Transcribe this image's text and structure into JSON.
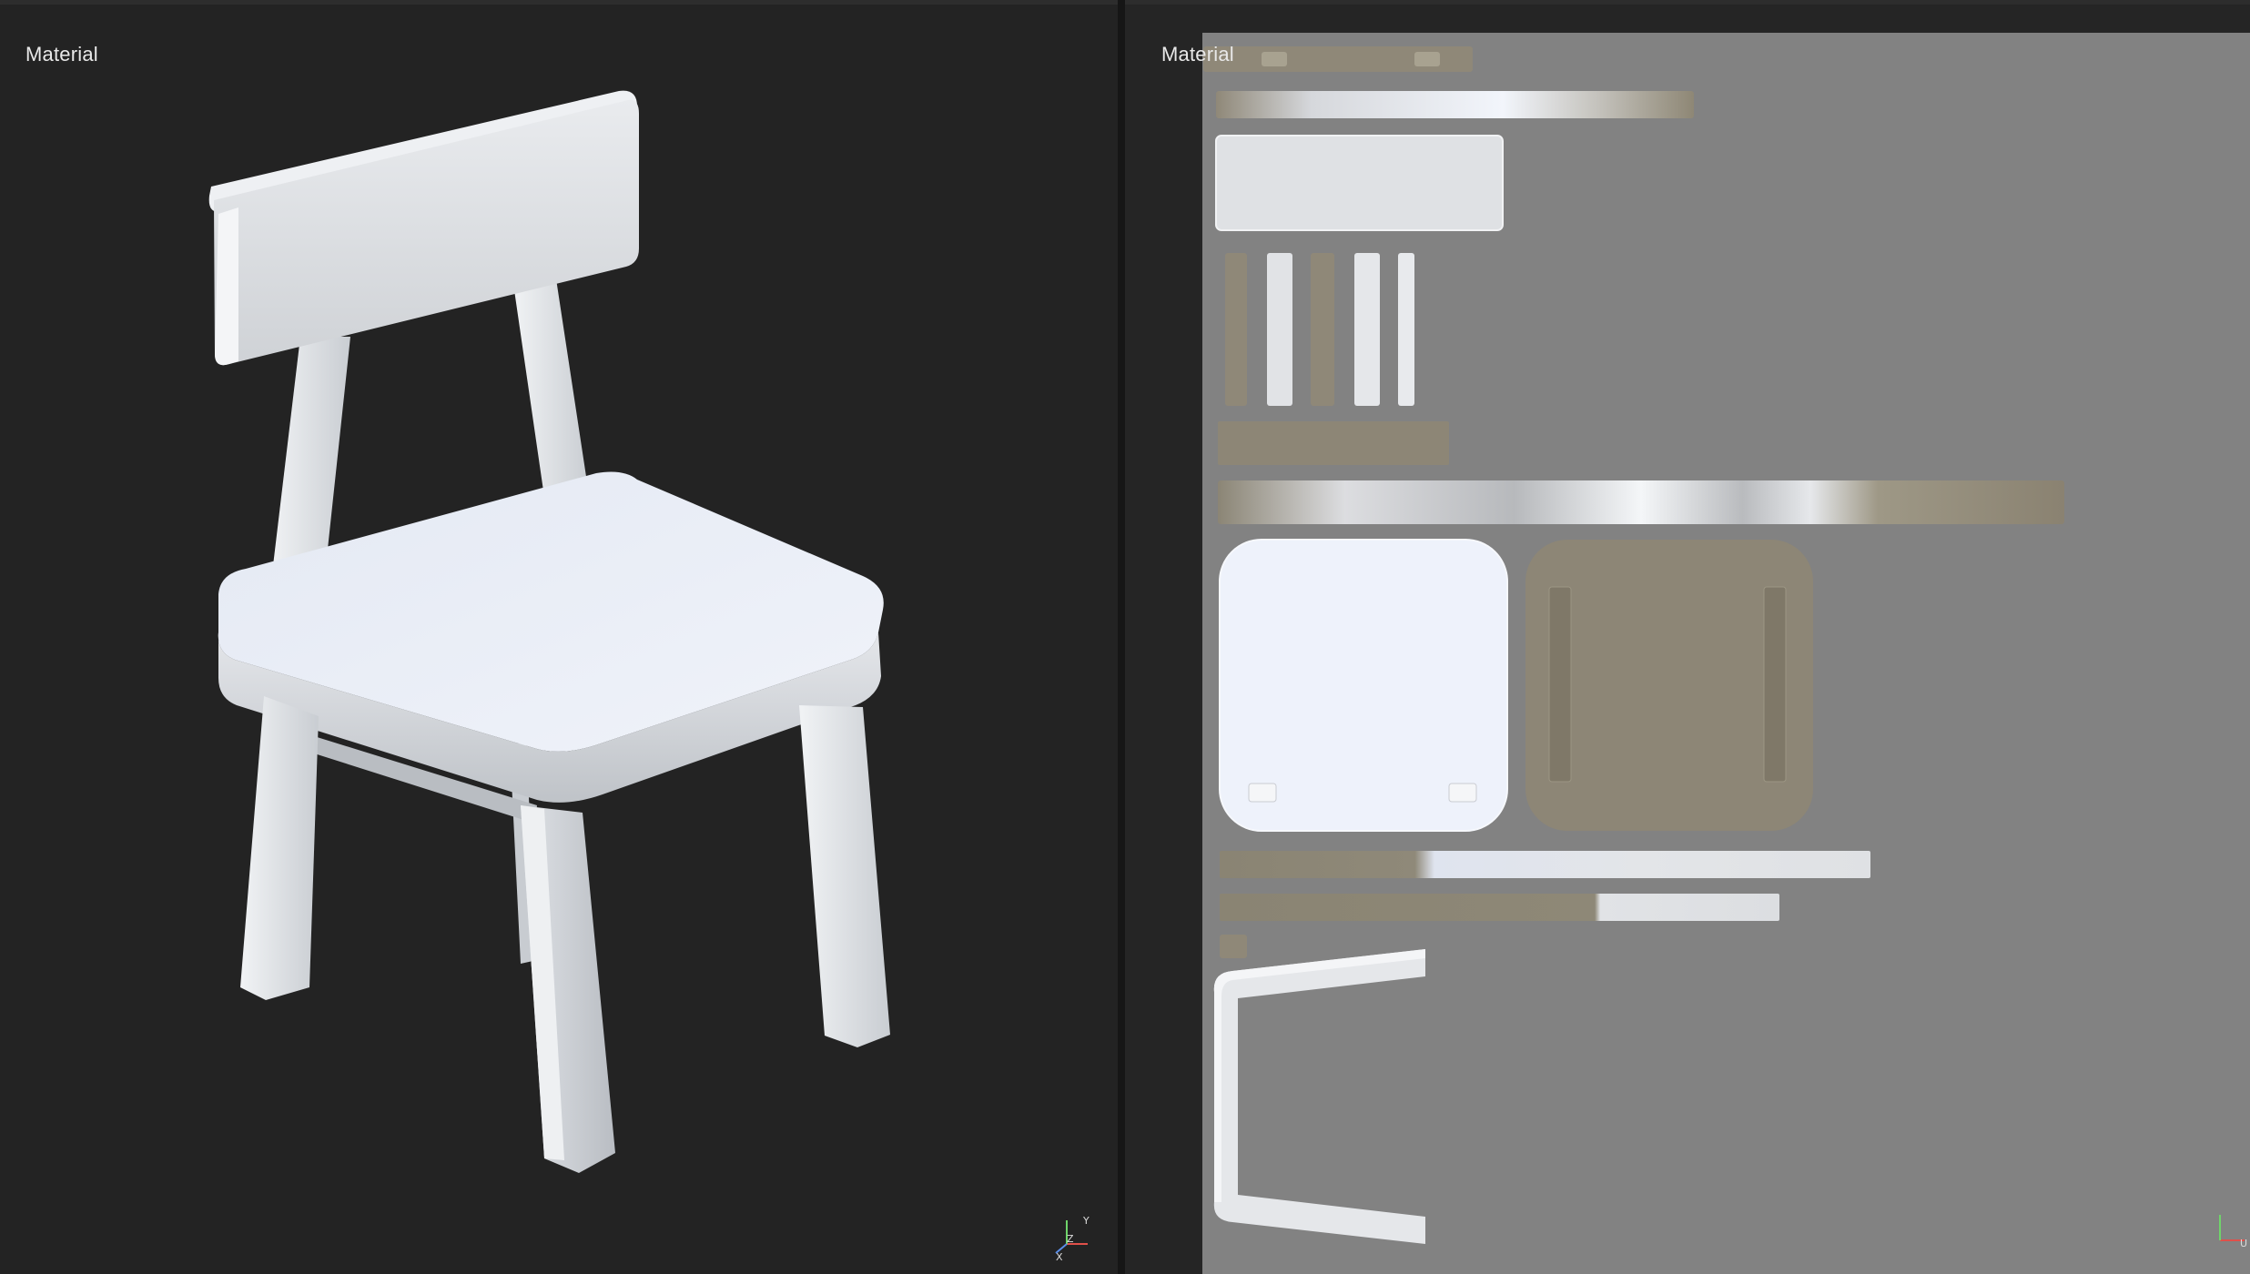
{
  "viewports": {
    "perspective": {
      "label": "Material",
      "axes": {
        "y": "Y",
        "z": "Z",
        "x": "X"
      }
    },
    "uv": {
      "label": "Material",
      "axes": {
        "u": "U"
      }
    }
  },
  "colors": {
    "background": "#232323",
    "uv_background": "#828282",
    "material_white": "#e6e9ee",
    "material_tan": "#8d8676",
    "axis_x": "#e0504a",
    "axis_y": "#6fd46a",
    "axis_z": "#5a8de8"
  }
}
